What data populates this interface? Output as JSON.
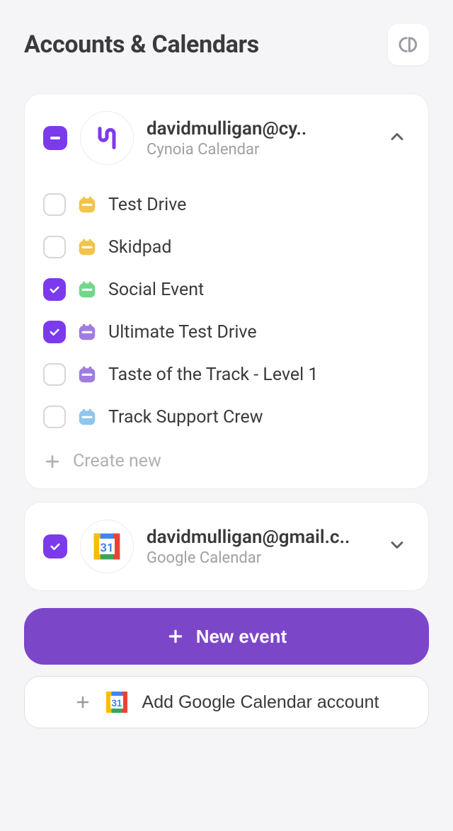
{
  "header": {
    "title": "Accounts & Calendars"
  },
  "accounts": [
    {
      "state": "indeterminate",
      "email": "davidmulligan@cy..",
      "provider": "Cynoia Calendar",
      "expanded": true,
      "calendars": [
        {
          "checked": false,
          "color": "#f2c44c",
          "name": "Test Drive"
        },
        {
          "checked": false,
          "color": "#f2c44c",
          "name": "Skidpad"
        },
        {
          "checked": true,
          "color": "#74d68a",
          "name": "Social Event"
        },
        {
          "checked": true,
          "color": "#a07ce0",
          "name": "Ultimate Test Drive"
        },
        {
          "checked": false,
          "color": "#a07ce0",
          "name": "Taste of the Track - Level 1"
        },
        {
          "checked": false,
          "color": "#8ec6ee",
          "name": "Track Support Crew"
        }
      ],
      "create_label": "Create new"
    },
    {
      "state": "checked",
      "email": "davidmulligan@gmail.c..",
      "provider": "Google Calendar",
      "expanded": false
    }
  ],
  "actions": {
    "new_event": "New event",
    "add_google": "Add Google Calendar account"
  }
}
